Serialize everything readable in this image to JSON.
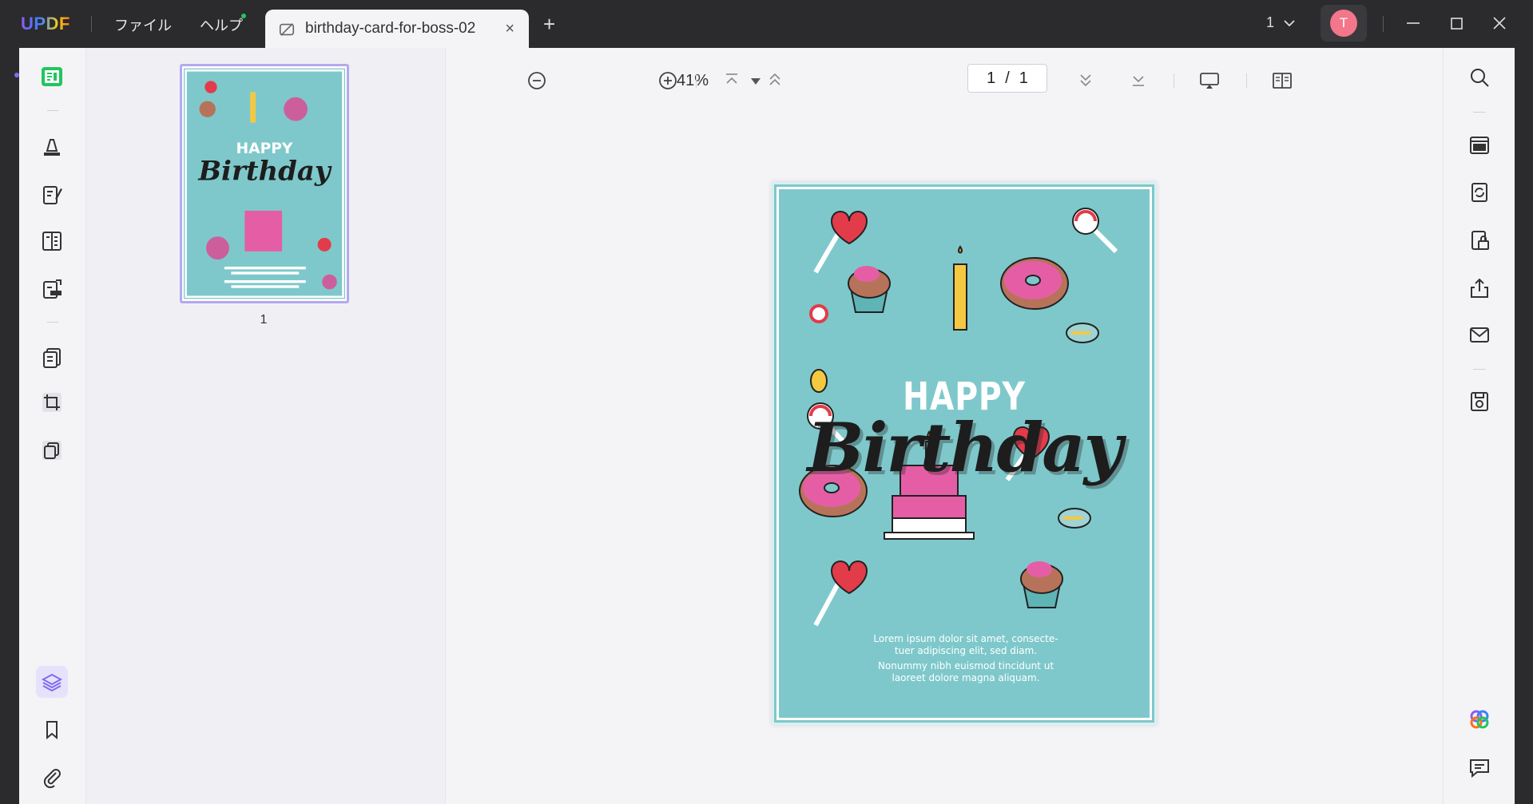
{
  "app": {
    "logo": "UPDF"
  },
  "menu": {
    "file": "ファイル",
    "help": "ヘルプ"
  },
  "tab": {
    "title": "birthday-card-for-boss-02",
    "close": "×",
    "add": "+"
  },
  "window": {
    "page_count": "1",
    "avatar_letter": "T"
  },
  "thumbnail": {
    "page_number": "1"
  },
  "viewer": {
    "zoom": "41%",
    "current_page": "1",
    "separator": "/",
    "total_pages": "1"
  },
  "card": {
    "happy": "HAPPY",
    "birthday": "Birthday",
    "text1_line1": "Lorem ipsum dolor sit amet, consecte-",
    "text1_line2": "tuer adipiscing elit, sed diam.",
    "text2_line1": "Nonummy nibh euismod tincidunt ut",
    "text2_line2": "laoreet dolore magna aliquam."
  },
  "icons": {
    "left": [
      "reader-icon",
      "highlighter-icon",
      "edit-pdf-icon",
      "form-icon",
      "sign-icon",
      "organize-pages-icon",
      "crop-icon",
      "copy-pages-icon",
      "layers-icon",
      "bookmark-icon",
      "attachment-icon"
    ],
    "right": [
      "search-icon",
      "ocr-icon",
      "convert-icon",
      "protect-icon",
      "share-icon",
      "mail-icon",
      "save-icon",
      "ai-assistant-icon",
      "comment-icon"
    ]
  },
  "colors": {
    "accent": "#7c6cf0",
    "reader_active": "#22c55e",
    "card_bg": "#7ec8cb",
    "avatar": "#f3768a"
  }
}
